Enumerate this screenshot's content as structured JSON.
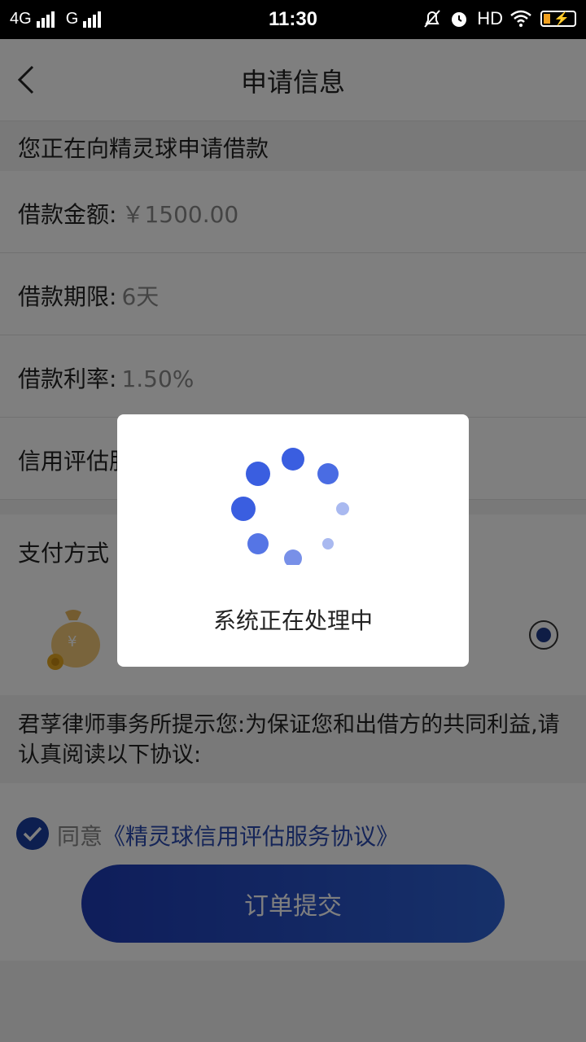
{
  "status_bar": {
    "network1": "4G",
    "network2": "G",
    "time": "11:30",
    "hd": "HD"
  },
  "nav": {
    "title": "申请信息"
  },
  "loan": {
    "intro": "您正在向精灵球申请借款",
    "amount_label": "借款金额:",
    "amount_value": "￥1500.00",
    "term_label": "借款期限:",
    "term_value": "6天",
    "rate_label": "借款利率:",
    "rate_value": "1.50%",
    "credit_label_partial": "信用评估服"
  },
  "payment": {
    "section_title": "支付方式"
  },
  "notice": {
    "text": "君莩律师事务所提示您:为保证您和出借方的共同利益,请认真阅读以下协议:"
  },
  "agreement": {
    "agree_label": "同意",
    "link_text": "《精灵球信用评估服务协议》"
  },
  "submit": {
    "label": "订单提交"
  },
  "dialog": {
    "message": "系统正在处理中"
  },
  "colors": {
    "accent": "#2a4bb0",
    "button_start": "#1e3bb5",
    "button_end": "#2e62d4",
    "spinner": "#3a5ee0"
  }
}
